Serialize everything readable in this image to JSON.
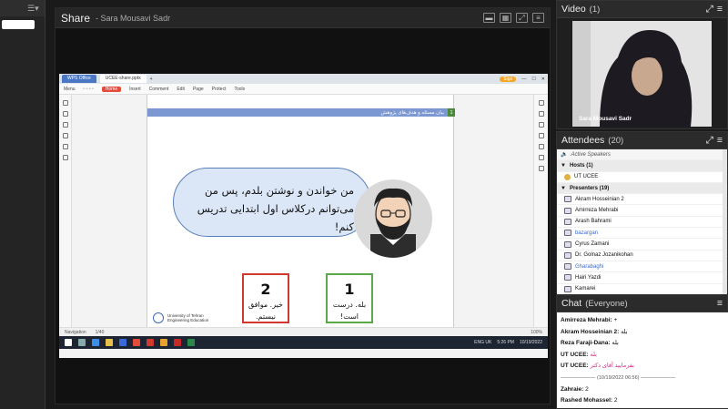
{
  "share": {
    "title": "Share",
    "presenter": "Sara Mousavi Sadr"
  },
  "screen": {
    "tabs": [
      "WPS Office",
      "UCEE-share.pptx"
    ],
    "account_badge": "Sign",
    "toolbar_items": [
      "Menu",
      "Home",
      "Insert",
      "Comment",
      "Edit",
      "Page",
      "Protect",
      "Tools"
    ],
    "doc": {
      "banner_text": "بیان مسئله و هدف‌های پژوهش",
      "banner_num": "1",
      "bubble_line1": "من خواندن و نوشتن بلدم، پس من",
      "bubble_line2": "می‌توانم درکلاس اول ابتدایی تدریس کنم!",
      "card_no_num": "2",
      "card_no_line1": "خیر. موافق",
      "card_no_line2": "نیستم.",
      "card_yes_num": "1",
      "card_yes_line1": "بله. درست",
      "card_yes_line2": "است!",
      "footer_line1": "University of Tehran",
      "footer_line2": "Engineering Education"
    },
    "statusbar": {
      "navigation": "Navigation",
      "page": "1/40",
      "zoom": "100%"
    },
    "taskbar": {
      "lang": "ENG UK",
      "time": "5:26 PM",
      "date": "10/19/2022"
    }
  },
  "video": {
    "title": "Video",
    "count": "(1)",
    "participant": "Sara Mousavi Sadr"
  },
  "attendees": {
    "title": "Attendees",
    "count": "(20)",
    "active_speakers": "Active Speakers",
    "hosts_label": "Hosts (1)",
    "host": "UT UCEE",
    "presenters_label": "Presenters (19)",
    "presenters": [
      {
        "name": "Akram Hosseinian 2",
        "blue": false
      },
      {
        "name": "Amirreza Mehrabi",
        "blue": false
      },
      {
        "name": "Arash Bahrami",
        "blue": false
      },
      {
        "name": "bazargan",
        "blue": true
      },
      {
        "name": "Cyrus Zamani",
        "blue": false
      },
      {
        "name": "Dr. Golnaz Jozanikohan",
        "blue": false
      },
      {
        "name": "Gharabaghi",
        "blue": true
      },
      {
        "name": "Hairi Yazdi",
        "blue": false
      },
      {
        "name": "Kamarei",
        "blue": false
      }
    ]
  },
  "chat": {
    "title": "Chat",
    "scope": "(Everyone)",
    "messages": [
      {
        "sender": "Amirreza Mehrabi:",
        "text": "+",
        "pink": false
      },
      {
        "sender": "Akram Hosseinian 2:",
        "text": "بله",
        "pink": false
      },
      {
        "sender": "Reza Faraji-Dana:",
        "text": "بله",
        "pink": false
      },
      {
        "sender": "UT UCEE:",
        "text": "بله",
        "pink": true
      },
      {
        "sender": "UT UCEE:",
        "text": "بفرمایید آقای دکتر",
        "pink": true
      }
    ],
    "separator": "——————— (10/19/2022 06:56) ———————",
    "messages_after": [
      {
        "sender": "Zahraie:",
        "text": "2"
      },
      {
        "sender": "Rashed Mohassel:",
        "text": "2"
      }
    ]
  },
  "colors": {
    "banner": "#7b98d3",
    "card_no": "#d13a2f",
    "card_yes": "#5aa84a",
    "chat_pink": "#d0308a"
  }
}
